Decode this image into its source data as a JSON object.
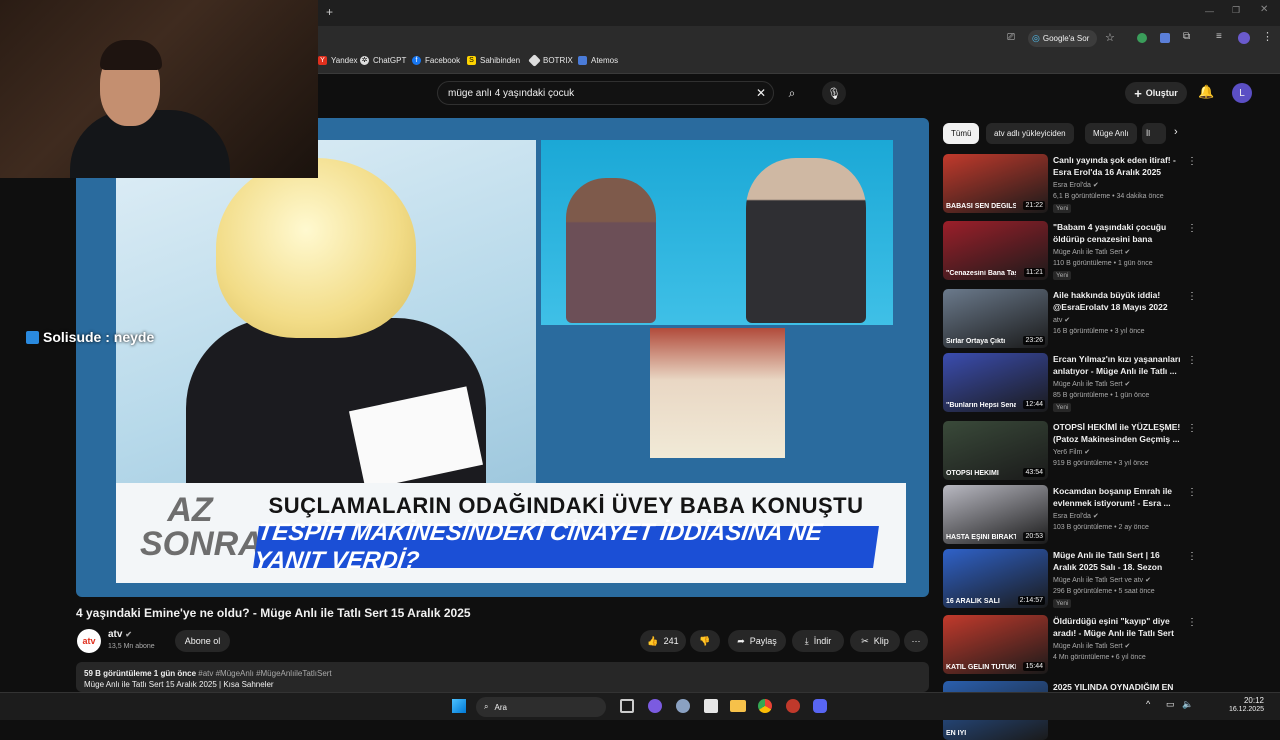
{
  "browser": {
    "new_tab_symbol": "+",
    "google_btn": "Google'a Sor",
    "bookmarks": [
      {
        "label": "Yandex",
        "icon": "yandex-icon"
      },
      {
        "label": "ChatGPT",
        "icon": "chatgpt-icon"
      },
      {
        "label": "Facebook",
        "icon": "facebook-icon"
      },
      {
        "label": "Sahibinden",
        "icon": "sahibinden-icon"
      },
      {
        "label": "BOTRIX",
        "icon": "botrix-icon"
      },
      {
        "label": "Atemos",
        "icon": "atemos-icon"
      }
    ]
  },
  "header": {
    "search_value": "müge anlı 4 yaşındaki çocuk",
    "create_label": "Oluştur",
    "avatar_letter": "L"
  },
  "video": {
    "az_sonra": "AZ SONRA",
    "headline1": "SUÇLAMALARIN ODAĞINDAKİ ÜVEY BABA KONUŞTU",
    "headline2": "TESPİH MAKİNESİNDEKİ CİNAYET İDDİASINA NE YANIT VERDİ?",
    "title": "4 yaşındaki Emine'ye ne oldu? - Müge Anlı ile Tatlı Sert 15 Aralık 2025",
    "channel": "atv",
    "channel_avatar_text": "atv",
    "subscribers": "13,5 Mn abone",
    "subscribe_label": "Abone ol",
    "likes": "241",
    "share_label": "Paylaş",
    "download_label": "İndir",
    "clip_label": "Klip",
    "desc_meta": "59 B görüntüleme  1 gün önce",
    "desc_tags": "#atv #MügeAnlı #MügeAnlıileTatlıSert",
    "desc_line2": "Müge Anlı ile Tatlı Sert 15 Aralık 2025 | Kısa Sahneler"
  },
  "overlay_text": "Solisude : neyde",
  "chips": [
    "Tümü",
    "atv adlı yükleyiciden",
    "Müge Anlı",
    "İl"
  ],
  "recommendations": [
    {
      "title": "Canlı yayında şok eden itiraf! - Esra Erol'da 16 Aralık 2025",
      "channel": "Esra Erol'da",
      "meta": "6,1 B görüntüleme • 34 dakika önce",
      "duration": "21:22",
      "new": "Yeni",
      "thumb_text": "BABASI SEN DEĞİLSİN",
      "color": "#c23a2c"
    },
    {
      "title": "\"Babam 4 yaşındaki çocuğu öldürüp cenazesini bana taşıttı...",
      "channel": "Müge Anlı ile Tatlı Sert",
      "meta": "110 B görüntüleme • 1 gün önce",
      "duration": "11:21",
      "new": "Yeni",
      "thumb_text": "\"Cenazesini Bana Taşıttı\"",
      "color": "#9c1f2a"
    },
    {
      "title": "Aile hakkında büyük iddia! @EsraErolatv 18 Mayıs 2022",
      "channel": "atv",
      "meta": "16 B görüntüleme • 3 yıl önce",
      "duration": "23:26",
      "new": "",
      "thumb_text": "Sırlar Ortaya Çıktı",
      "color": "#6b7a8c"
    },
    {
      "title": "Ercan Yılmaz'ın kızı yaşananları anlatıyor - Müge Anlı ile Tatlı ...",
      "channel": "Müge Anlı ile Tatlı Sert",
      "meta": "85 B görüntüleme • 1 gün önce",
      "duration": "12:44",
      "new": "Yeni",
      "thumb_text": "\"Bunların Hepsi Senaryo\"",
      "color": "#3b4db0"
    },
    {
      "title": "OTOPSİ HEKİMİ ile YÜZLEŞME! (Patoz Makinesinden Geçmiş ...",
      "channel": "Yer6 Film",
      "meta": "919 B görüntüleme • 3 yıl önce",
      "duration": "43:54",
      "new": "",
      "thumb_text": "OTOPSİ HEKİMİ",
      "color": "#3a4a3a"
    },
    {
      "title": "Kocamdan boşanıp Emrah ile evlenmek istiyorum! - Esra ...",
      "channel": "Esra Erol'da",
      "meta": "103 B görüntüleme • 2 ay önce",
      "duration": "20:53",
      "new": "",
      "thumb_text": "HASTA EŞİNİ BIRAKTI",
      "color": "#b9b9c2"
    },
    {
      "title": "Müge Anlı ile Tatlı Sert | 16 Aralık 2025 Salı - 18. Sezon",
      "channel": "Müge Anlı ile Tatlı Sert ve atv",
      "meta": "296 B görüntüleme • 5 saat önce",
      "duration": "2:14:57",
      "new": "Yeni",
      "thumb_text": "16 ARALIK SALI",
      "color": "#2f62c9"
    },
    {
      "title": "Öldürdüğü eşini \"kayıp\" diye aradı! - Müge Anlı ile Tatlı Sert ...",
      "channel": "Müge Anlı ile Tatlı Sert",
      "meta": "4 Mn görüntüleme • 6 yıl önce",
      "duration": "15:44",
      "new": "",
      "thumb_text": "KATİL GELİN TUTUKLANDI",
      "color": "#c23a2c"
    },
    {
      "title": "2025 YILINDA OYNADIĞIM EN",
      "channel": "",
      "meta": "",
      "duration": "",
      "new": "",
      "thumb_text": "EN İYİ",
      "color": "#2a5fae"
    }
  ],
  "taskbar": {
    "search_label": "Ara",
    "time": "20:12",
    "date": "16.12.2025"
  }
}
